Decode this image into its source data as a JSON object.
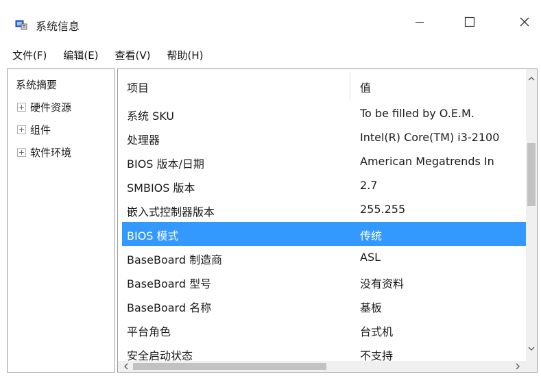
{
  "window": {
    "title": "系统信息",
    "icons": {
      "app": "system-info-icon",
      "minimize": "minimize-icon",
      "maximize": "maximize-icon",
      "close": "close-icon"
    }
  },
  "menu": [
    "文件(F)",
    "编辑(E)",
    "查看(V)",
    "帮助(H)"
  ],
  "tree": {
    "root": "系统摘要",
    "nodes": [
      "硬件资源",
      "组件",
      "软件环境"
    ]
  },
  "table": {
    "headers": [
      "项目",
      "值"
    ],
    "rows": [
      {
        "item": "系统 SKU",
        "value": "To be filled by O.E.M."
      },
      {
        "item": "处理器",
        "value": "Intel(R) Core(TM) i3-2100"
      },
      {
        "item": "BIOS 版本/日期",
        "value": "American Megatrends In"
      },
      {
        "item": "SMBIOS 版本",
        "value": "2.7"
      },
      {
        "item": "嵌入式控制器版本",
        "value": "255.255"
      },
      {
        "item": "BIOS 模式",
        "value": "传统"
      },
      {
        "item": "BaseBoard 制造商",
        "value": "ASL"
      },
      {
        "item": "BaseBoard 型号",
        "value": "没有资料"
      },
      {
        "item": "BaseBoard 名称",
        "value": "基板"
      },
      {
        "item": "平台角色",
        "value": "台式机"
      },
      {
        "item": "安全启动状态",
        "value": "不支持"
      }
    ],
    "selected_index": 5
  },
  "colors": {
    "selection": "#3399ff",
    "selection_text": "#ffffff"
  }
}
